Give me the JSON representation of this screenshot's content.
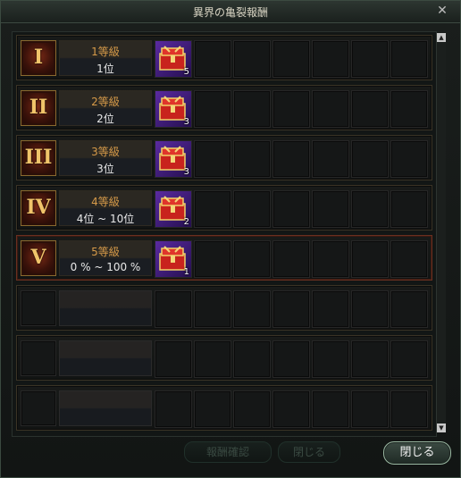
{
  "window": {
    "title": "異界の亀裂報酬",
    "close_glyph": "✕"
  },
  "rows": [
    {
      "numeral": "I",
      "grade": "1等級",
      "range": "1位",
      "reward_count": "5"
    },
    {
      "numeral": "II",
      "grade": "2等級",
      "range": "2位",
      "reward_count": "3"
    },
    {
      "numeral": "III",
      "grade": "3等級",
      "range": "3位",
      "reward_count": "3"
    },
    {
      "numeral": "IV",
      "grade": "4等級",
      "range": "4位 ~ 10位",
      "reward_count": "2"
    },
    {
      "numeral": "V",
      "grade": "5等級",
      "range": "0 % ~ 100 %",
      "reward_count": "1"
    }
  ],
  "empty_rows": 3,
  "slots_per_row": 7,
  "buttons": {
    "disabled_left": "報酬確認",
    "disabled_right": "閉じる",
    "close": "閉じる"
  },
  "scrollbar": {
    "up_glyph": "▲",
    "down_glyph": "▼"
  },
  "colors": {
    "grade_text": "#d69a49",
    "numeral": "#f1c46a",
    "chest": "#5a2aa0",
    "accent_red": "#d4302a"
  },
  "icons": {
    "reward": "red-treasure-chest-icon"
  }
}
